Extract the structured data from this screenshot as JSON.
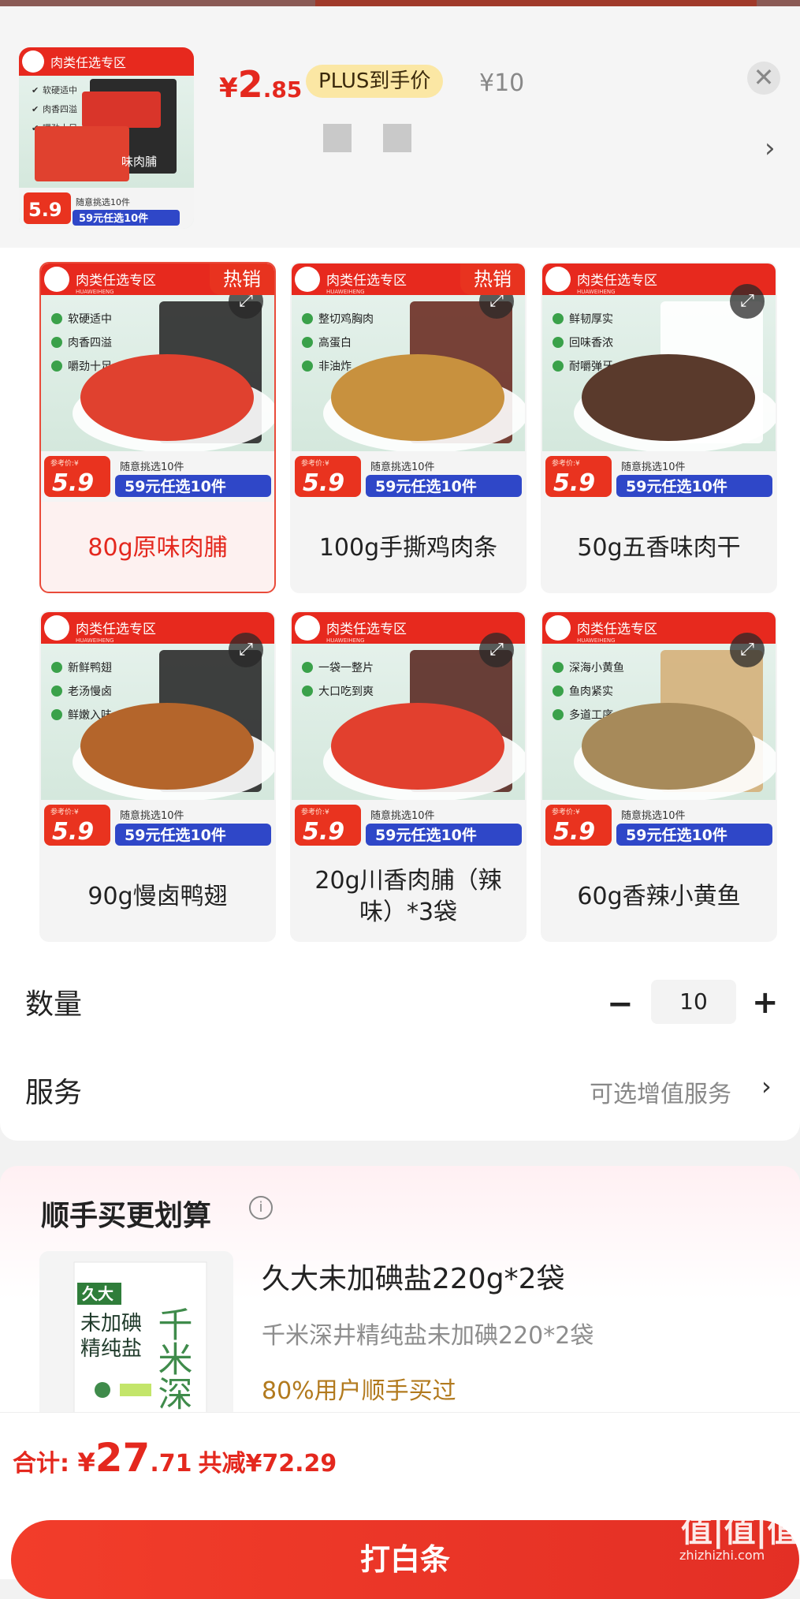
{
  "header": {
    "price_symbol": "¥",
    "price_int": "2",
    "price_dec": ".85",
    "plus_badge": "PLUS到手价",
    "orig_price": "¥10",
    "close_glyph": "✕",
    "arrow_glyph": "›"
  },
  "variants": [
    {
      "label": "80g原味肉脯",
      "hot": "热销",
      "selected": true
    },
    {
      "label": "100g手撕鸡肉条",
      "hot": "热销"
    },
    {
      "label": "50g五香味肉干"
    },
    {
      "label": "90g慢卤鸭翅"
    },
    {
      "label": "20g川香肉脯（辣味）*3袋"
    },
    {
      "label": "60g香辣小黄鱼"
    }
  ],
  "product_image_text": {
    "banner": "肉类任选专区",
    "brand_sub": "HUAWEIHENG",
    "price_tag": "5.9",
    "ref_price": "参考价:¥",
    "pick_any": "随意挑选10件",
    "promo": "59元任选10件",
    "jerky_pack": "味肉脯",
    "features": [
      [
        "软硬适中",
        "肉香四溢",
        "嚼劲十足"
      ],
      [
        "整切鸡胸肉",
        "高蛋白",
        "非油炸"
      ],
      [
        "鲜韧厚实",
        "回味香浓",
        "耐嚼弹牙"
      ],
      [
        "新鲜鸭翅",
        "老汤慢卤",
        "鲜嫩入味"
      ],
      [
        "一袋一整片",
        "大口吃到爽"
      ],
      [
        "深海小黄鱼",
        "鱼肉紧实",
        "多道工序"
      ]
    ]
  },
  "quantity": {
    "label": "数量",
    "value": "10",
    "minus": "−",
    "plus": "+"
  },
  "service": {
    "label": "服务",
    "value": "可选增值服务",
    "arrow": "›"
  },
  "bundle": {
    "title": "顺手买更划算",
    "info_glyph": "i",
    "name": "久大未加碘盐220g*2袋",
    "desc": "千米深井精纯盐未加碘220*2袋",
    "note": "80%用户顺手买过",
    "pack_brand": "久大",
    "pack_line1": "未加碘",
    "pack_line2": "精纯盐",
    "pack_side": "千米深"
  },
  "footer": {
    "total_label": "合计: ",
    "total_symbol": "¥",
    "total_int": "27",
    "total_dec": ".71",
    "save_text": "共减¥72.29",
    "pay_button": "打白条"
  },
  "watermark": {
    "main": "值|值|值",
    "sub": "zhizhizhi.com"
  },
  "colors": {
    "accent": "#e4281e",
    "plus_gold": "#fbe7a4",
    "note_gold": "#b27a1e"
  }
}
